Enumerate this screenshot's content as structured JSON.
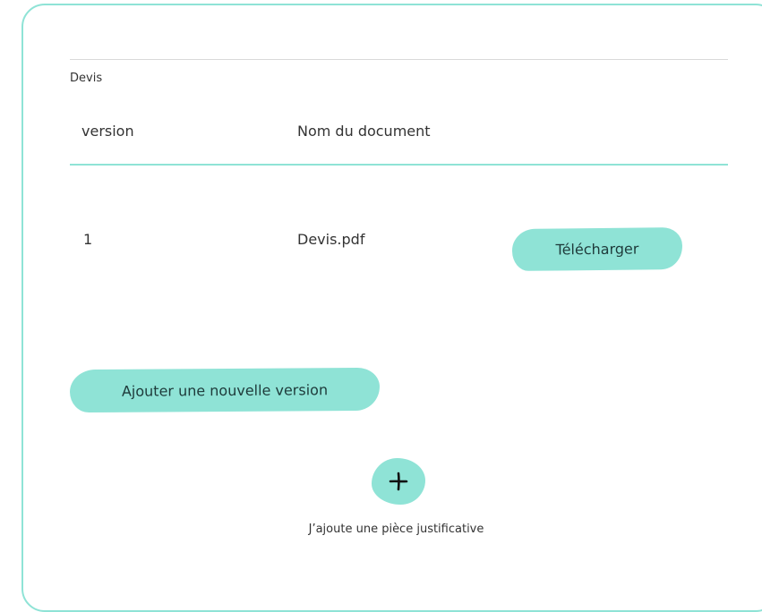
{
  "section": {
    "title": "Devis"
  },
  "table": {
    "columns": [
      "version",
      "Nom du document"
    ],
    "rows": [
      {
        "version": "1",
        "document_name": "Devis.pdf",
        "action_label": "Télécharger"
      }
    ]
  },
  "actions": {
    "add_version_label": "Ajouter une nouvelle version",
    "add_attachment_caption": "J’ajoute une pièce justificative",
    "add_attachment_icon": "plus-icon"
  },
  "colors": {
    "accent": "#8fe3d6",
    "text": "#333333",
    "divider": "#d9d9d9"
  }
}
